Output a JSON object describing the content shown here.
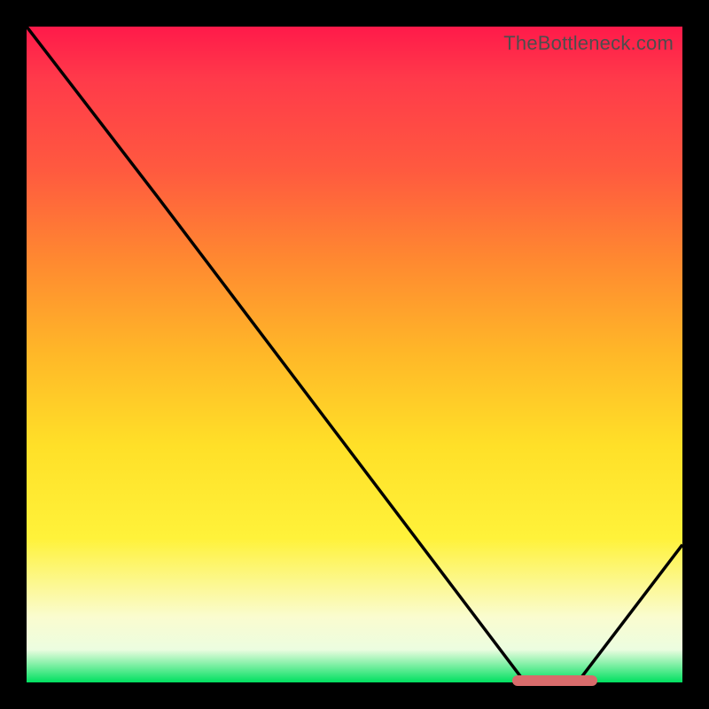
{
  "attribution": "TheBottleneck.com",
  "chart_data": {
    "type": "line",
    "title": "",
    "xlabel": "",
    "ylabel": "",
    "xlim": [
      0,
      100
    ],
    "ylim": [
      0,
      100
    ],
    "x": [
      0,
      20,
      76,
      84,
      100
    ],
    "values": [
      100,
      74,
      0,
      0,
      21
    ],
    "marker": {
      "x_start": 74,
      "x_end": 87,
      "y": 0
    },
    "grid": false,
    "legend": null
  },
  "colors": {
    "gradient_top": "#ff1a4a",
    "gradient_bottom": "#00e060",
    "line": "#000000",
    "marker": "#d86b6b",
    "frame_bg": "#000000"
  }
}
